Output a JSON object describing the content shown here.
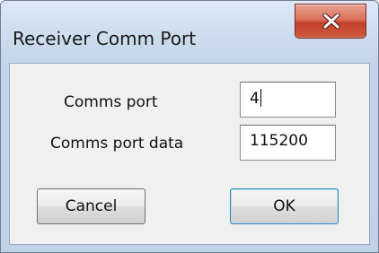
{
  "window": {
    "title": "Receiver Comm Port"
  },
  "title_bar": {
    "close_icon": "close-icon"
  },
  "form": {
    "comms_port_label": "Comms port",
    "comms_port_value": "4",
    "comms_port_data_label": "Comms port data",
    "comms_port_data_value": "115200"
  },
  "buttons": {
    "cancel_label": "Cancel",
    "ok_label": "OK"
  },
  "colors": {
    "close_button": "#c4412a",
    "title_bar": "#c3d5ea",
    "client_background": "#f0f0f0"
  }
}
